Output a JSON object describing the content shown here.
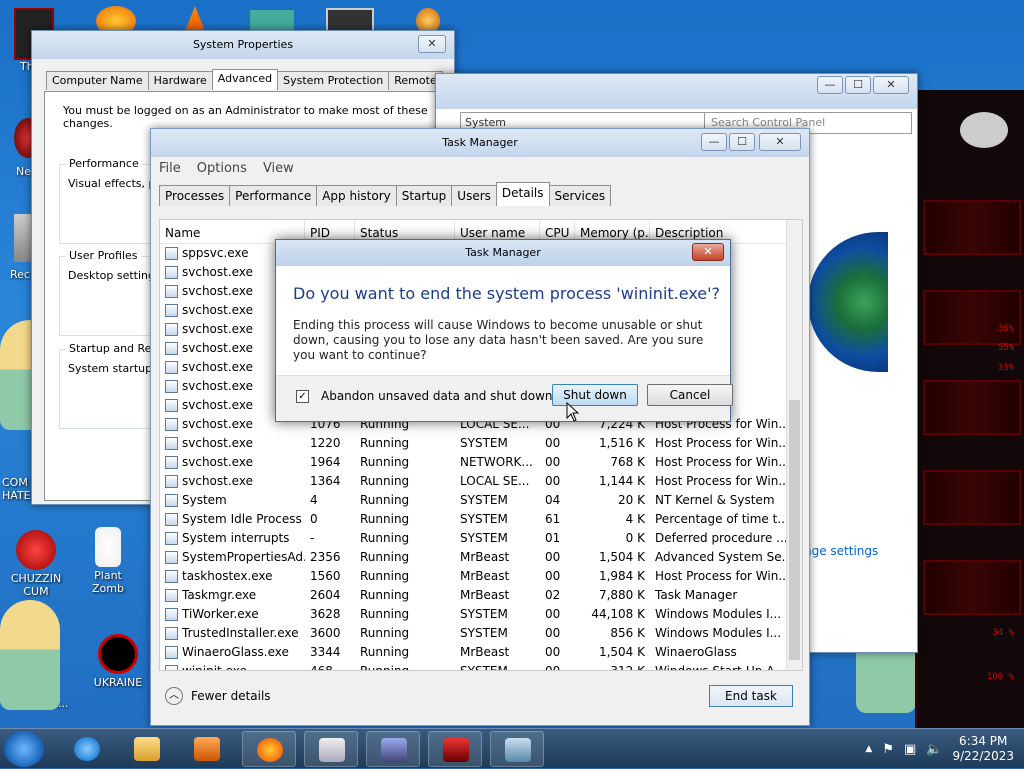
{
  "desktop": {
    "icons": [
      {
        "label": "Th"
      },
      {
        "label": "Ne"
      },
      {
        "label": "Rec"
      },
      {
        "label": "COM HATE"
      },
      {
        "label": "CHUZZIN CUM"
      },
      {
        "label": "Plant Zomb"
      },
      {
        "label": "ed ...A..."
      },
      {
        "label": "UKRAINE"
      }
    ],
    "percent_readouts": [
      "36%",
      "55%",
      "33%",
      "34 %",
      "100 %"
    ]
  },
  "system_properties": {
    "title": "System Properties",
    "close": "✕",
    "tabs": [
      "Computer Name",
      "Hardware",
      "Advanced",
      "System Protection",
      "Remote"
    ],
    "selected_tab": "Advanced",
    "notice": "You must be logged on as an Administrator to make most of these changes.",
    "groups": [
      {
        "label": "Performance",
        "text": "Visual effects, pro"
      },
      {
        "label": "User Profiles",
        "text": "Desktop settings"
      },
      {
        "label": "Startup and Reco",
        "text": "System startup, sy"
      }
    ]
  },
  "control_panel": {
    "minimize": "—",
    "maximize": "☐",
    "close": "✕",
    "address": "System",
    "search_placeholder": "Search Control Panel",
    "link": "nge settings"
  },
  "task_manager": {
    "title": "Task Manager",
    "minimize": "—",
    "maximize": "☐",
    "close": "✕",
    "menu": [
      "File",
      "Options",
      "View"
    ],
    "tabs": [
      "Processes",
      "Performance",
      "App history",
      "Startup",
      "Users",
      "Details",
      "Services"
    ],
    "selected_tab": "Details",
    "columns": [
      "Name",
      "PID",
      "Status",
      "User name",
      "CPU",
      "Memory (p...",
      "Description"
    ],
    "rows": [
      {
        "name": "sppsvc.exe",
        "pid": "",
        "status": "",
        "user": "",
        "cpu": "",
        "mem": "",
        "desc": "ftware P..."
      },
      {
        "name": "svchost.exe",
        "pid": "",
        "status": "",
        "user": "",
        "cpu": "",
        "mem": "",
        "desc": "for Win..."
      },
      {
        "name": "svchost.exe",
        "pid": "",
        "status": "",
        "user": "",
        "cpu": "",
        "mem": "",
        "desc": "for Win..."
      },
      {
        "name": "svchost.exe",
        "pid": "",
        "status": "",
        "user": "",
        "cpu": "",
        "mem": "",
        "desc": "for Win..."
      },
      {
        "name": "svchost.exe",
        "pid": "",
        "status": "",
        "user": "",
        "cpu": "",
        "mem": "",
        "desc": "for Win..."
      },
      {
        "name": "svchost.exe",
        "pid": "",
        "status": "",
        "user": "",
        "cpu": "",
        "mem": "",
        "desc": "for Win..."
      },
      {
        "name": "svchost.exe",
        "pid": "",
        "status": "",
        "user": "",
        "cpu": "",
        "mem": "",
        "desc": "for Win..."
      },
      {
        "name": "svchost.exe",
        "pid": "",
        "status": "",
        "user": "",
        "cpu": "",
        "mem": "",
        "desc": "for Win..."
      },
      {
        "name": "svchost.exe",
        "pid": "",
        "status": "",
        "user": "",
        "cpu": "",
        "mem": "",
        "desc": "for Win..."
      },
      {
        "name": "svchost.exe",
        "pid": "1076",
        "status": "Running",
        "user": "LOCAL SE...",
        "cpu": "00",
        "mem": "7,224 K",
        "desc": "Host Process for Win..."
      },
      {
        "name": "svchost.exe",
        "pid": "1220",
        "status": "Running",
        "user": "SYSTEM",
        "cpu": "00",
        "mem": "1,516 K",
        "desc": "Host Process for Win..."
      },
      {
        "name": "svchost.exe",
        "pid": "1964",
        "status": "Running",
        "user": "NETWORK...",
        "cpu": "00",
        "mem": "768 K",
        "desc": "Host Process for Win..."
      },
      {
        "name": "svchost.exe",
        "pid": "1364",
        "status": "Running",
        "user": "LOCAL SE...",
        "cpu": "00",
        "mem": "1,144 K",
        "desc": "Host Process for Win..."
      },
      {
        "name": "System",
        "pid": "4",
        "status": "Running",
        "user": "SYSTEM",
        "cpu": "04",
        "mem": "20 K",
        "desc": "NT Kernel & System"
      },
      {
        "name": "System Idle Process",
        "pid": "0",
        "status": "Running",
        "user": "SYSTEM",
        "cpu": "61",
        "mem": "4 K",
        "desc": "Percentage of time t..."
      },
      {
        "name": "System interrupts",
        "pid": "-",
        "status": "Running",
        "user": "SYSTEM",
        "cpu": "01",
        "mem": "0 K",
        "desc": "Deferred procedure ..."
      },
      {
        "name": "SystemPropertiesAd...",
        "pid": "2356",
        "status": "Running",
        "user": "MrBeast",
        "cpu": "00",
        "mem": "1,504 K",
        "desc": "Advanced System Se..."
      },
      {
        "name": "taskhostex.exe",
        "pid": "1560",
        "status": "Running",
        "user": "MrBeast",
        "cpu": "00",
        "mem": "1,984 K",
        "desc": "Host Process for Win..."
      },
      {
        "name": "Taskmgr.exe",
        "pid": "2604",
        "status": "Running",
        "user": "MrBeast",
        "cpu": "02",
        "mem": "7,880 K",
        "desc": "Task Manager"
      },
      {
        "name": "TiWorker.exe",
        "pid": "3628",
        "status": "Running",
        "user": "SYSTEM",
        "cpu": "00",
        "mem": "44,108 K",
        "desc": "Windows Modules I..."
      },
      {
        "name": "TrustedInstaller.exe",
        "pid": "3600",
        "status": "Running",
        "user": "SYSTEM",
        "cpu": "00",
        "mem": "856 K",
        "desc": "Windows Modules I..."
      },
      {
        "name": "WinaeroGlass.exe",
        "pid": "3344",
        "status": "Running",
        "user": "MrBeast",
        "cpu": "00",
        "mem": "1,504 K",
        "desc": "WinaeroGlass"
      },
      {
        "name": "wininit.exe",
        "pid": "468",
        "status": "Running",
        "user": "SYSTEM",
        "cpu": "00",
        "mem": "312 K",
        "desc": "Windows Start-Up A..."
      }
    ],
    "fewer_details": "Fewer details",
    "end_task": "End task"
  },
  "dialog": {
    "title": "Task Manager",
    "close": "✕",
    "question": "Do you want to end the system process 'wininit.exe'?",
    "message": "Ending this process will cause Windows to become unusable or shut down, causing you to lose any data hasn't been saved. Are you sure you want to continue?",
    "checkbox_label": "Abandon unsaved data and shut down.",
    "checkbox_checked": true,
    "checkbox_mark": "✓",
    "shutdown_label": "Shut down",
    "cancel_label": "Cancel"
  },
  "taskbar": {
    "pinned": [
      "Internet Explorer",
      "File Explorer",
      "Media Player",
      "Firefox",
      "Performance Monitor",
      "Control Panel",
      "Game",
      "System Properties"
    ],
    "tray_up": "▲",
    "tray_flag": "⚑",
    "tray_network": "▣",
    "tray_volume": "🔈",
    "time": "6:34 PM",
    "date": "9/22/2023"
  },
  "colors": {
    "dialog_heading": "#1c3d8c",
    "link": "#0066cc",
    "close_red": "#c4432a"
  }
}
